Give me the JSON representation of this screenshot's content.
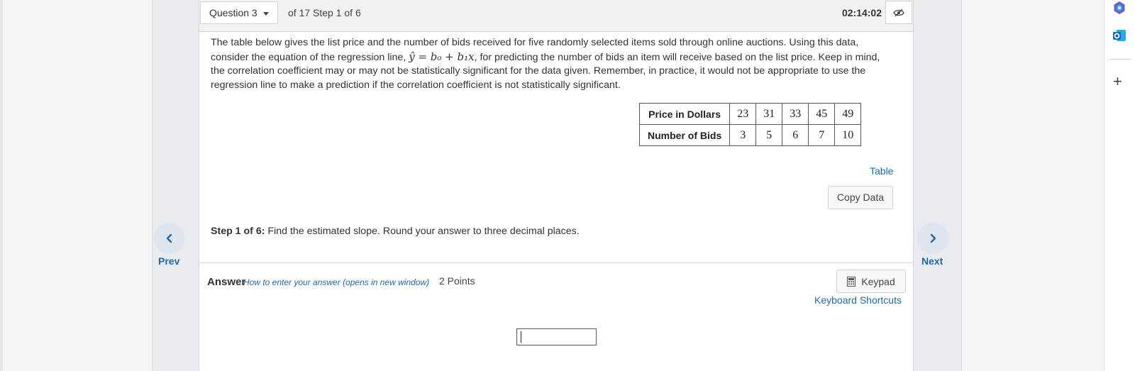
{
  "question": {
    "selector_label": "Question 3",
    "progress": "of 17 Step 1 of 6",
    "timer": "02:14:02"
  },
  "problem": {
    "text_before": "The table below gives the list price and the number of bids received for five randomly selected items sold through online auctions. Using this data, consider the equation of the regression line,",
    "equation": "ŷ = b₀ + b₁x",
    "text_after": ", for predicting the number of bids an item will receive based on the list price. Keep in mind, the correlation coefficient may or may not be statistically significant for the data given. Remember, in practice, it would not be appropriate to use the regression line to make a prediction if the correlation coefficient is not statistically significant."
  },
  "data_table": {
    "row1_label": "Price in Dollars",
    "row1": [
      "23",
      "31",
      "33",
      "45",
      "49"
    ],
    "row2_label": "Number of Bids",
    "row2": [
      "3",
      "5",
      "6",
      "7",
      "10"
    ]
  },
  "links": {
    "table": "Table",
    "copy_data": "Copy Data"
  },
  "step": {
    "label": "Step 1 of 6:",
    "text": " Find the estimated slope. Round your answer to three decimal places."
  },
  "answer": {
    "label": "Answer",
    "how_to": "How to enter your answer (opens in new window)",
    "points": "2 Points",
    "keypad": "Keypad",
    "shortcuts": "Keyboard Shortcuts",
    "value": ""
  },
  "nav": {
    "prev": "Prev",
    "next": "Next"
  },
  "icons": {
    "dropdown": "chevron-down-icon",
    "visibility": "eye-slash-icon",
    "keypad": "calculator-icon",
    "prev": "chevron-left-icon",
    "next": "chevron-right-icon",
    "sidebar": [
      "copilot-icon",
      "outlook-icon",
      "plus-icon"
    ]
  },
  "colors": {
    "link": "#1e6aa9",
    "nav_circle": "#dde5ee"
  }
}
